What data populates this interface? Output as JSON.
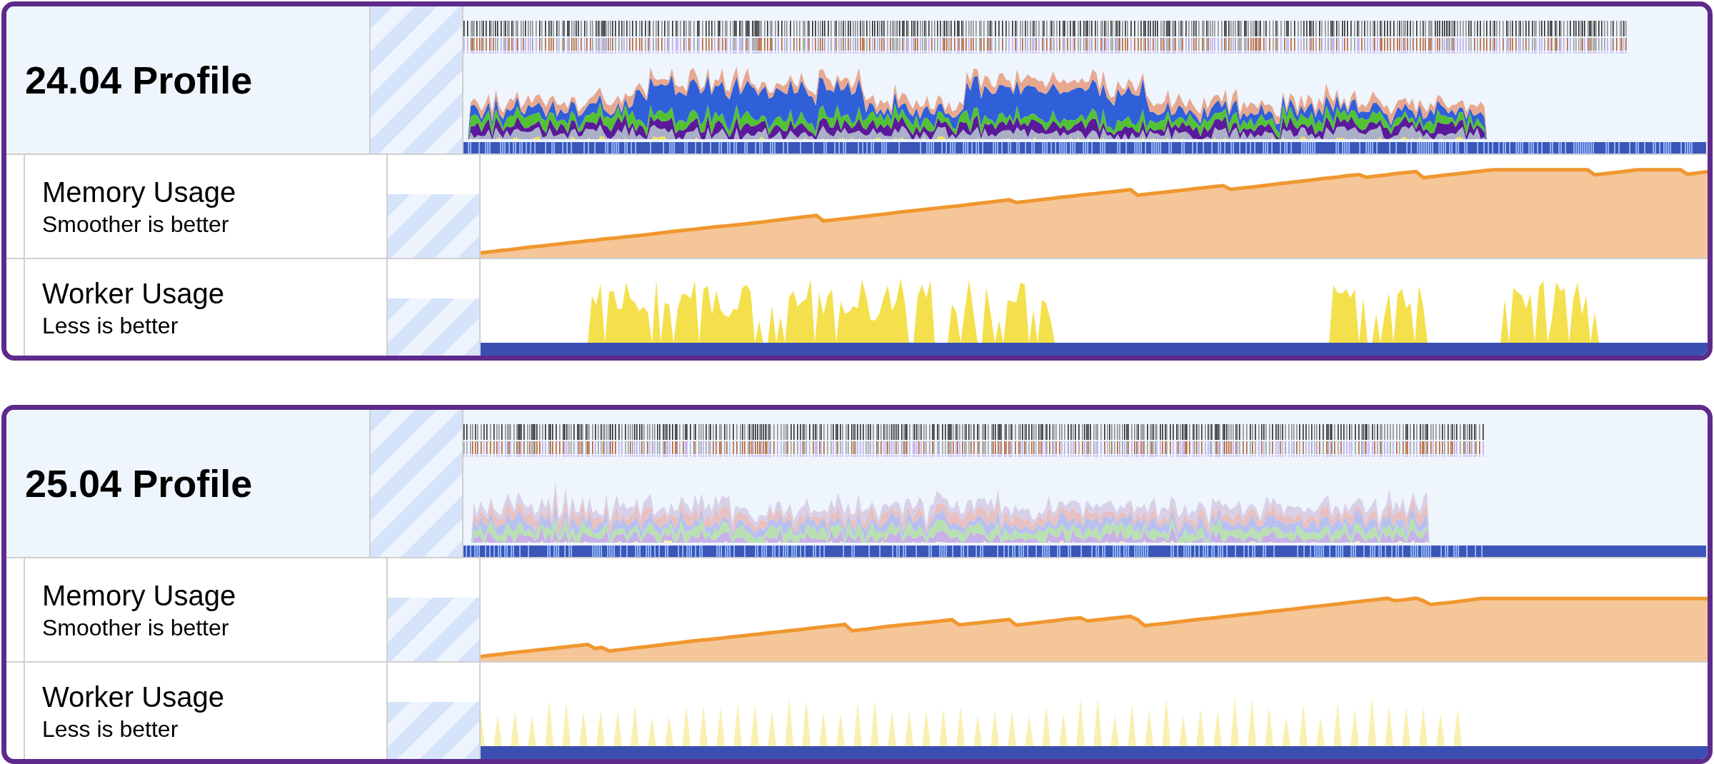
{
  "profiles": [
    {
      "title": "24.04 Profile",
      "tracks": [
        {
          "kind": "memory",
          "label": "Memory Usage",
          "hint": "Smoother is better"
        },
        {
          "kind": "worker",
          "label": "Worker Usage",
          "hint": "Less is better"
        }
      ]
    },
    {
      "title": "25.04 Profile",
      "tracks": [
        {
          "kind": "memory",
          "label": "Memory Usage",
          "hint": "Smoother is better"
        },
        {
          "kind": "worker",
          "label": "Worker Usage",
          "hint": "Less is better"
        }
      ]
    }
  ]
}
